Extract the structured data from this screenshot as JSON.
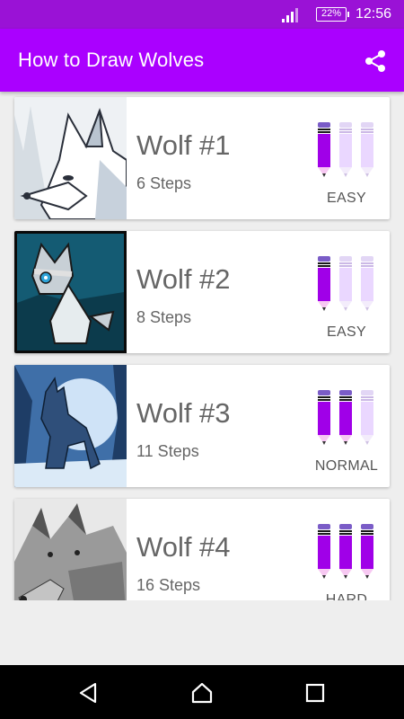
{
  "status_bar": {
    "battery": "22%",
    "time": "12:56"
  },
  "app_bar": {
    "title": "How to Draw Wolves",
    "share_icon": "share-icon"
  },
  "items": [
    {
      "name": "Wolf #1",
      "steps": "6 Steps",
      "difficulty": "EASY",
      "filled_pencils": 1
    },
    {
      "name": "Wolf #2",
      "steps": "8 Steps",
      "difficulty": "EASY",
      "filled_pencils": 1
    },
    {
      "name": "Wolf #3",
      "steps": "11 Steps",
      "difficulty": "NORMAL",
      "filled_pencils": 2
    },
    {
      "name": "Wolf #4",
      "steps": "16 Steps",
      "difficulty": "HARD",
      "filled_pencils": 3
    }
  ],
  "colors": {
    "status_bar": "#9a12d6",
    "app_bar": "#aa00ff",
    "pencil_filled": "#a000e8",
    "pencil_empty": "#ead7ff"
  },
  "nav": {
    "back_icon": "back-icon",
    "home_icon": "home-icon",
    "recents_icon": "recents-icon"
  }
}
